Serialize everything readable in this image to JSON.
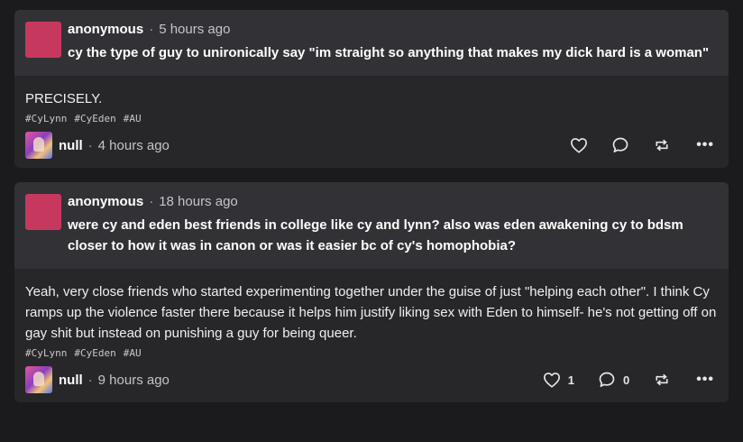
{
  "posts": [
    {
      "ask": {
        "name": "anonymous",
        "separator": "·",
        "time": "5 hours ago",
        "question": "cy the type of guy to unironically say \"im straight so anything that makes my dick hard is a woman\""
      },
      "answer": "PRECISELY.",
      "tags": [
        "#CyLynn",
        "#CyEden",
        "#AU"
      ],
      "author": {
        "name": "null",
        "separator": "·",
        "time": "4 hours ago"
      },
      "actions": {
        "like_icon": "heart-icon",
        "like_count": "",
        "reply_icon": "speech-bubble-icon",
        "reply_count": "",
        "reblog_icon": "repost-icon",
        "more_label": "•••"
      }
    },
    {
      "ask": {
        "name": "anonymous",
        "separator": "·",
        "time": "18 hours ago",
        "question": "were cy and eden best friends in college like cy and lynn? also was eden awakening cy to bdsm closer to how it was in canon or was it easier bc of cy's homophobia?"
      },
      "answer": "Yeah, very close friends who started experimenting together under the guise of just \"helping each other\". I think Cy ramps up the violence faster there because it helps him justify liking sex with Eden to himself- he's not getting off on gay shit but instead on punishing a guy for being queer.",
      "tags": [
        "#CyLynn",
        "#CyEden",
        "#AU"
      ],
      "author": {
        "name": "null",
        "separator": "·",
        "time": "9 hours ago"
      },
      "actions": {
        "like_icon": "heart-icon",
        "like_count": "1",
        "reply_icon": "speech-bubble-icon",
        "reply_count": "0",
        "reblog_icon": "repost-icon",
        "more_label": "•••"
      }
    }
  ],
  "colors": {
    "background": "#1b1b1d",
    "card": "#27272a",
    "ask_card": "#323236",
    "ask_avatar": "#c7385f"
  }
}
